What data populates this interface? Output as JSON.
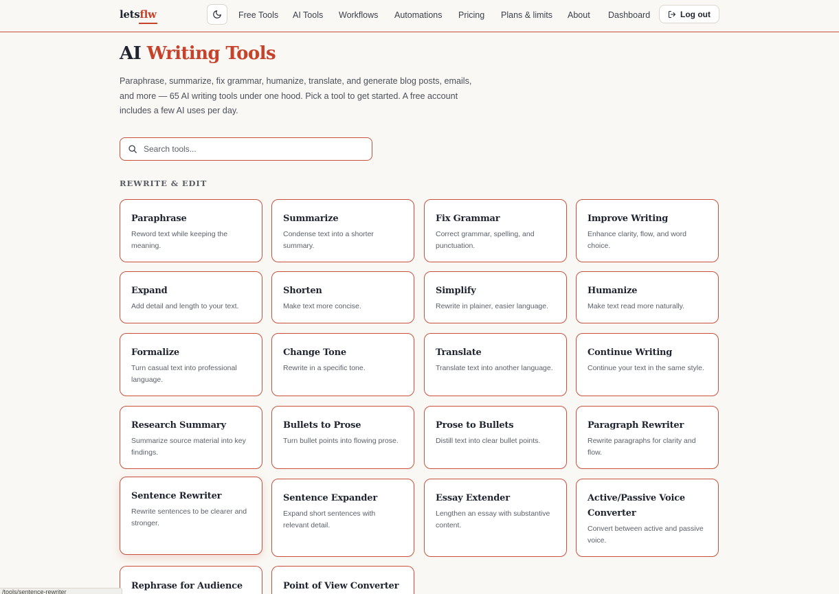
{
  "header": {
    "logo_part1": "lets",
    "logo_part2": "flw",
    "theme_icon": "moon-icon",
    "nav": [
      "Free Tools",
      "AI Tools",
      "Workflows",
      "Automations",
      "Pricing",
      "Plans & limits",
      "About",
      "Dashboard"
    ],
    "logout_icon": "logout-icon",
    "logout_label": "Log out"
  },
  "hero": {
    "title_part1": "AI",
    "title_part2": "Writing Tools",
    "intro": "Paraphrase, summarize, fix grammar, humanize, translate, and generate blog posts, emails, and more — 65 AI writing tools under one hood. Pick a tool to get started. A free account includes a few AI uses per day."
  },
  "search": {
    "icon": "search-icon",
    "placeholder": "Search tools..."
  },
  "section": {
    "heading": "REWRITE & EDIT",
    "tools": [
      {
        "title": "Paraphrase",
        "desc": "Reword text while keeping the meaning."
      },
      {
        "title": "Summarize",
        "desc": "Condense text into a shorter summary."
      },
      {
        "title": "Fix Grammar",
        "desc": "Correct grammar, spelling, and punctuation."
      },
      {
        "title": "Improve Writing",
        "desc": "Enhance clarity, flow, and word choice."
      },
      {
        "title": "Expand",
        "desc": "Add detail and length to your text."
      },
      {
        "title": "Shorten",
        "desc": "Make text more concise."
      },
      {
        "title": "Simplify",
        "desc": "Rewrite in plainer, easier language."
      },
      {
        "title": "Humanize",
        "desc": "Make text read more naturally."
      },
      {
        "title": "Formalize",
        "desc": "Turn casual text into professional language."
      },
      {
        "title": "Change Tone",
        "desc": "Rewrite in a specific tone."
      },
      {
        "title": "Translate",
        "desc": "Translate text into another language."
      },
      {
        "title": "Continue Writing",
        "desc": "Continue your text in the same style."
      },
      {
        "title": "Research Summary",
        "desc": "Summarize source material into key findings."
      },
      {
        "title": "Bullets to Prose",
        "desc": "Turn bullet points into flowing prose."
      },
      {
        "title": "Prose to Bullets",
        "desc": "Distill text into clear bullet points."
      },
      {
        "title": "Paragraph Rewriter",
        "desc": "Rewrite paragraphs for clarity and flow."
      },
      {
        "title": "Sentence Rewriter",
        "desc": "Rewrite sentences to be clearer and stronger."
      },
      {
        "title": "Sentence Expander",
        "desc": "Expand short sentences with relevant detail."
      },
      {
        "title": "Essay Extender",
        "desc": "Lengthen an essay with substantive content."
      },
      {
        "title": "Active/Passive Voice Converter",
        "desc": "Convert between active and passive voice."
      },
      {
        "title": "Rephrase for Audience",
        "desc": ""
      },
      {
        "title": "Point of View Converter",
        "desc": ""
      }
    ]
  },
  "status_url": "/tools/sentence-rewriter"
}
